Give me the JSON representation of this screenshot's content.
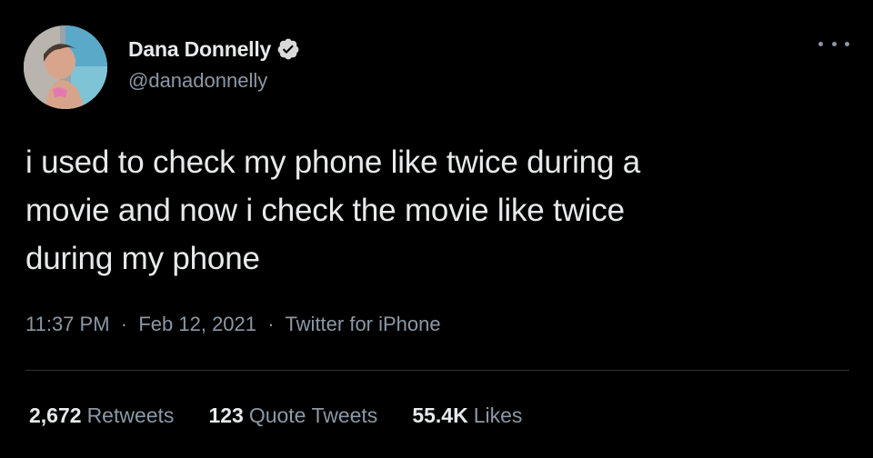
{
  "author": {
    "display_name": "Dana Donnelly",
    "handle": "@danadonnelly",
    "verified": true,
    "avatar_icon": "profile-photo"
  },
  "tweet": {
    "text_lines": [
      "i used to check my phone like twice during a",
      "movie and now i check the movie like twice",
      "during my phone"
    ]
  },
  "meta": {
    "time": "11:37 PM",
    "separator": "·",
    "date": "Feb 12, 2021",
    "source": "Twitter for iPhone"
  },
  "stats": [
    {
      "value": "2,672",
      "label": "Retweets"
    },
    {
      "value": "123",
      "label": "Quote Tweets"
    },
    {
      "value": "55.4K",
      "label": "Likes"
    }
  ],
  "colors": {
    "background": "#000000",
    "primary_text": "#e7e9ea",
    "secondary_text": "#8b98a5",
    "divider": "#2f3336",
    "verified_badge": "#d9d9d9"
  },
  "icons": {
    "verified": "verified-badge-icon",
    "more": "more-options-icon"
  }
}
